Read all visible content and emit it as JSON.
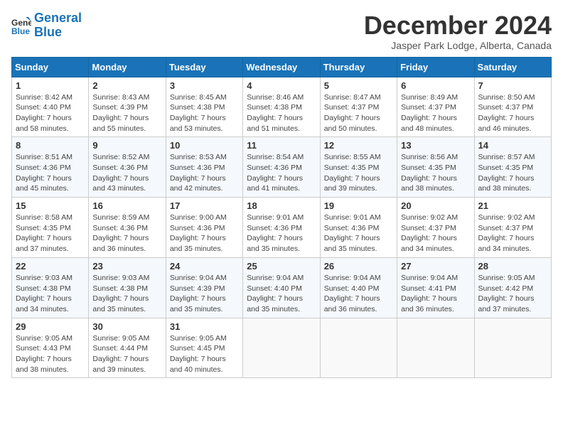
{
  "logo": {
    "line1": "General",
    "line2": "Blue"
  },
  "title": "December 2024",
  "location": "Jasper Park Lodge, Alberta, Canada",
  "headers": [
    "Sunday",
    "Monday",
    "Tuesday",
    "Wednesday",
    "Thursday",
    "Friday",
    "Saturday"
  ],
  "weeks": [
    [
      {
        "day": "1",
        "detail": "Sunrise: 8:42 AM\nSunset: 4:40 PM\nDaylight: 7 hours\nand 58 minutes."
      },
      {
        "day": "2",
        "detail": "Sunrise: 8:43 AM\nSunset: 4:39 PM\nDaylight: 7 hours\nand 55 minutes."
      },
      {
        "day": "3",
        "detail": "Sunrise: 8:45 AM\nSunset: 4:38 PM\nDaylight: 7 hours\nand 53 minutes."
      },
      {
        "day": "4",
        "detail": "Sunrise: 8:46 AM\nSunset: 4:38 PM\nDaylight: 7 hours\nand 51 minutes."
      },
      {
        "day": "5",
        "detail": "Sunrise: 8:47 AM\nSunset: 4:37 PM\nDaylight: 7 hours\nand 50 minutes."
      },
      {
        "day": "6",
        "detail": "Sunrise: 8:49 AM\nSunset: 4:37 PM\nDaylight: 7 hours\nand 48 minutes."
      },
      {
        "day": "7",
        "detail": "Sunrise: 8:50 AM\nSunset: 4:37 PM\nDaylight: 7 hours\nand 46 minutes."
      }
    ],
    [
      {
        "day": "8",
        "detail": "Sunrise: 8:51 AM\nSunset: 4:36 PM\nDaylight: 7 hours\nand 45 minutes."
      },
      {
        "day": "9",
        "detail": "Sunrise: 8:52 AM\nSunset: 4:36 PM\nDaylight: 7 hours\nand 43 minutes."
      },
      {
        "day": "10",
        "detail": "Sunrise: 8:53 AM\nSunset: 4:36 PM\nDaylight: 7 hours\nand 42 minutes."
      },
      {
        "day": "11",
        "detail": "Sunrise: 8:54 AM\nSunset: 4:36 PM\nDaylight: 7 hours\nand 41 minutes."
      },
      {
        "day": "12",
        "detail": "Sunrise: 8:55 AM\nSunset: 4:35 PM\nDaylight: 7 hours\nand 39 minutes."
      },
      {
        "day": "13",
        "detail": "Sunrise: 8:56 AM\nSunset: 4:35 PM\nDaylight: 7 hours\nand 38 minutes."
      },
      {
        "day": "14",
        "detail": "Sunrise: 8:57 AM\nSunset: 4:35 PM\nDaylight: 7 hours\nand 38 minutes."
      }
    ],
    [
      {
        "day": "15",
        "detail": "Sunrise: 8:58 AM\nSunset: 4:35 PM\nDaylight: 7 hours\nand 37 minutes."
      },
      {
        "day": "16",
        "detail": "Sunrise: 8:59 AM\nSunset: 4:36 PM\nDaylight: 7 hours\nand 36 minutes."
      },
      {
        "day": "17",
        "detail": "Sunrise: 9:00 AM\nSunset: 4:36 PM\nDaylight: 7 hours\nand 35 minutes."
      },
      {
        "day": "18",
        "detail": "Sunrise: 9:01 AM\nSunset: 4:36 PM\nDaylight: 7 hours\nand 35 minutes."
      },
      {
        "day": "19",
        "detail": "Sunrise: 9:01 AM\nSunset: 4:36 PM\nDaylight: 7 hours\nand 35 minutes."
      },
      {
        "day": "20",
        "detail": "Sunrise: 9:02 AM\nSunset: 4:37 PM\nDaylight: 7 hours\nand 34 minutes."
      },
      {
        "day": "21",
        "detail": "Sunrise: 9:02 AM\nSunset: 4:37 PM\nDaylight: 7 hours\nand 34 minutes."
      }
    ],
    [
      {
        "day": "22",
        "detail": "Sunrise: 9:03 AM\nSunset: 4:38 PM\nDaylight: 7 hours\nand 34 minutes."
      },
      {
        "day": "23",
        "detail": "Sunrise: 9:03 AM\nSunset: 4:38 PM\nDaylight: 7 hours\nand 35 minutes."
      },
      {
        "day": "24",
        "detail": "Sunrise: 9:04 AM\nSunset: 4:39 PM\nDaylight: 7 hours\nand 35 minutes."
      },
      {
        "day": "25",
        "detail": "Sunrise: 9:04 AM\nSunset: 4:40 PM\nDaylight: 7 hours\nand 35 minutes."
      },
      {
        "day": "26",
        "detail": "Sunrise: 9:04 AM\nSunset: 4:40 PM\nDaylight: 7 hours\nand 36 minutes."
      },
      {
        "day": "27",
        "detail": "Sunrise: 9:04 AM\nSunset: 4:41 PM\nDaylight: 7 hours\nand 36 minutes."
      },
      {
        "day": "28",
        "detail": "Sunrise: 9:05 AM\nSunset: 4:42 PM\nDaylight: 7 hours\nand 37 minutes."
      }
    ],
    [
      {
        "day": "29",
        "detail": "Sunrise: 9:05 AM\nSunset: 4:43 PM\nDaylight: 7 hours\nand 38 minutes."
      },
      {
        "day": "30",
        "detail": "Sunrise: 9:05 AM\nSunset: 4:44 PM\nDaylight: 7 hours\nand 39 minutes."
      },
      {
        "day": "31",
        "detail": "Sunrise: 9:05 AM\nSunset: 4:45 PM\nDaylight: 7 hours\nand 40 minutes."
      },
      {
        "day": "",
        "detail": ""
      },
      {
        "day": "",
        "detail": ""
      },
      {
        "day": "",
        "detail": ""
      },
      {
        "day": "",
        "detail": ""
      }
    ]
  ]
}
